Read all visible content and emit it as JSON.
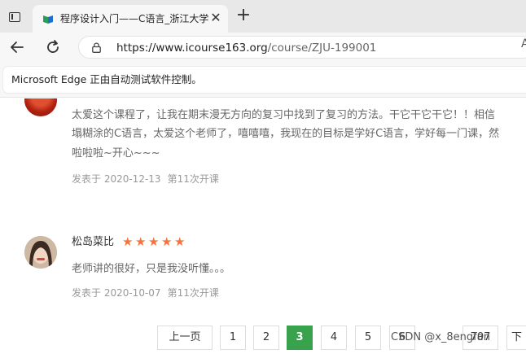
{
  "browser": {
    "tab_title": "程序设计入门——C语言_浙江大学",
    "new_tab_symbol": "+",
    "close_symbol": "✕",
    "url_host": "https://www.icourse163.org",
    "url_path": "/course/ZJU-199001",
    "profile_letter": "A",
    "infobar_text": "Microsoft Edge 正由自动测试软件控制。"
  },
  "comments": [
    {
      "lines": [
        "太爱这个课程了，让我在期末漫无方向的复习中找到了复习的方法。干它干它干它！！相信",
        "塌糊涂的C语言，太爱这个老师了，嘻嘻嘻，我现在的目标是学好C语言，学好每一门课，然",
        "啦啦啦~开心~~~"
      ],
      "date": "发表于 2020-12-13",
      "session": "第11次开课"
    },
    {
      "username": "松岛菜比",
      "rating": 5,
      "lines": [
        "老师讲的很好，只是我没听懂。。。"
      ],
      "date": "发表于 2020-10-07",
      "session": "第11次开课"
    }
  ],
  "pagination": {
    "prev": "上一页",
    "pages": [
      "1",
      "2",
      "3",
      "4",
      "5",
      "6"
    ],
    "active": "3",
    "last": "707",
    "next": "下"
  },
  "watermark": "CSDN @x_8engfan",
  "colors": {
    "active_page": "#39a24c",
    "star": "#f5743d"
  }
}
